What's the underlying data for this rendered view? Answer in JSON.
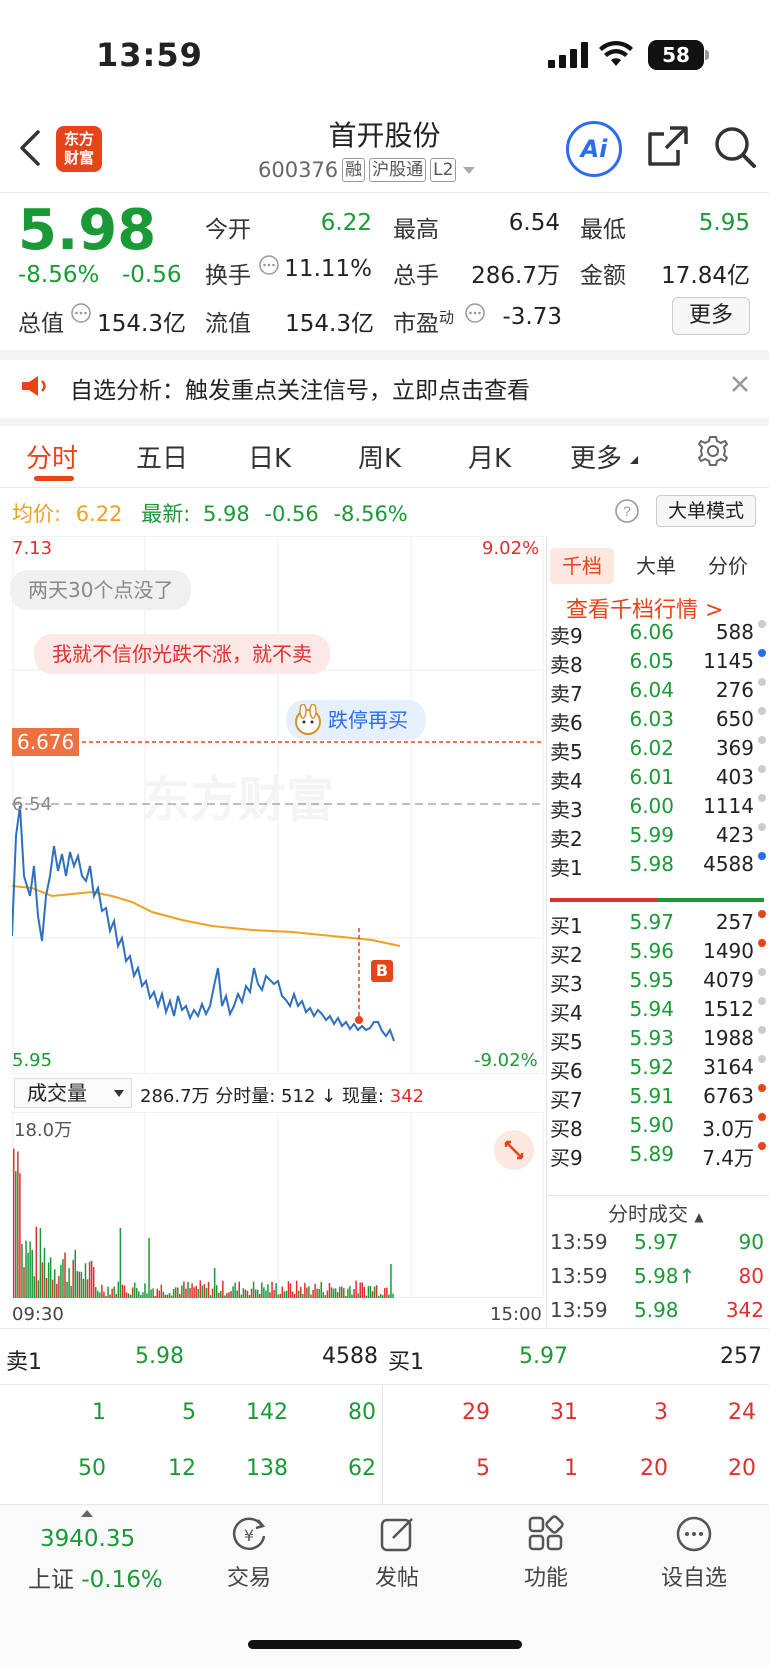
{
  "status_bar": {
    "time": "13:59",
    "battery": "58"
  },
  "header": {
    "title": "首开股份",
    "code": "600376",
    "tags": [
      "融",
      "沪股通",
      "L2"
    ],
    "logo_text": "东方财富"
  },
  "quote": {
    "price": "5.98",
    "change_pct": "-8.56%",
    "change": "-0.56",
    "fields": [
      {
        "label": "今开",
        "value": "6.22",
        "color": "green"
      },
      {
        "label": "最高",
        "value": "6.54",
        "color": "black"
      },
      {
        "label": "最低",
        "value": "5.95",
        "color": "green"
      },
      {
        "label": "换手",
        "value": "11.11%",
        "color": "black"
      },
      {
        "label": "总手",
        "value": "286.7万",
        "color": "black"
      },
      {
        "label": "金额",
        "value": "17.84亿",
        "color": "black"
      },
      {
        "label": "总值",
        "value": "154.3亿",
        "color": "black"
      },
      {
        "label": "流值",
        "value": "154.3亿",
        "color": "black"
      },
      {
        "label": "市盈",
        "label_sup": "动",
        "value": "-3.73",
        "color": "black"
      }
    ],
    "more_label": "更多"
  },
  "notice": {
    "text": "自选分析：触发重点关注信号，立即点击查看"
  },
  "tabs": [
    "分时",
    "五日",
    "日K",
    "周K",
    "月K",
    "更多"
  ],
  "intraday": {
    "avg_label": "均价:",
    "avg_value": "6.22",
    "latest_label": "最新:",
    "latest_value": "5.98",
    "latest_change": "-0.56",
    "latest_pct": "-8.56%",
    "mode_button": "大单模式",
    "y_top": "7.13",
    "y_bottom": "5.95",
    "pct_top": "9.02%",
    "pct_bottom": "-9.02%",
    "ref_price": "6.676",
    "high_price": "6.54",
    "watermark": "东方财富",
    "comment1": "两天30个点没了",
    "comment2": "我就不信你光跌不涨，就不卖",
    "comment3": "跌停再买",
    "b_marker": "B",
    "volume_label": "成交量",
    "volume_summary": "286.7万 分时量: 512",
    "volume_current_label": "现量:",
    "volume_current": "342",
    "volume_max": "18.0万",
    "time_start": "09:30",
    "time_end": "15:00"
  },
  "depth_tabs": [
    "千档",
    "大单",
    "分价"
  ],
  "depth_link": "查看千档行情 >",
  "asks": [
    {
      "label": "卖9",
      "price": "6.06",
      "vol": "588",
      "dot": "#cccccc"
    },
    {
      "label": "卖8",
      "price": "6.05",
      "vol": "1145",
      "dot": "#2a6cf6"
    },
    {
      "label": "卖7",
      "price": "6.04",
      "vol": "276",
      "dot": "#cccccc"
    },
    {
      "label": "卖6",
      "price": "6.03",
      "vol": "650",
      "dot": "#cccccc"
    },
    {
      "label": "卖5",
      "price": "6.02",
      "vol": "369",
      "dot": "#cccccc"
    },
    {
      "label": "卖4",
      "price": "6.01",
      "vol": "403",
      "dot": "#cccccc"
    },
    {
      "label": "卖3",
      "price": "6.00",
      "vol": "1114",
      "dot": "#cccccc"
    },
    {
      "label": "卖2",
      "price": "5.99",
      "vol": "423",
      "dot": "#cccccc"
    },
    {
      "label": "卖1",
      "price": "5.98",
      "vol": "4588",
      "dot": "#2a6cf6"
    }
  ],
  "bids": [
    {
      "label": "买1",
      "price": "5.97",
      "vol": "257",
      "dot": "#e8441a"
    },
    {
      "label": "买2",
      "price": "5.96",
      "vol": "1490",
      "dot": "#e8441a"
    },
    {
      "label": "买3",
      "price": "5.95",
      "vol": "4079",
      "dot": "#cccccc"
    },
    {
      "label": "买4",
      "price": "5.94",
      "vol": "1512",
      "dot": "#cccccc"
    },
    {
      "label": "买5",
      "price": "5.93",
      "vol": "1988",
      "dot": "#cccccc"
    },
    {
      "label": "买6",
      "price": "5.92",
      "vol": "3164",
      "dot": "#cccccc"
    },
    {
      "label": "买7",
      "price": "5.91",
      "vol": "6763",
      "dot": "#e8441a"
    },
    {
      "label": "买8",
      "price": "5.90",
      "vol": "3.0万",
      "dot": "#e8441a"
    },
    {
      "label": "买9",
      "price": "5.89",
      "vol": "7.4万",
      "dot": "#e8441a"
    }
  ],
  "trades_title": "分时成交",
  "trades": [
    {
      "time": "13:59",
      "price": "5.97",
      "vol": "90",
      "price_color": "green",
      "vol_color": "green"
    },
    {
      "time": "13:59",
      "price": "5.98↑",
      "vol": "80",
      "price_color": "green",
      "vol_color": "red"
    },
    {
      "time": "13:59",
      "price": "5.98",
      "vol": "342",
      "price_color": "green",
      "vol_color": "red"
    }
  ],
  "book": {
    "sell_label": "卖1",
    "sell_price": "5.98",
    "sell_vol": "4588",
    "buy_label": "买1",
    "buy_price": "5.97",
    "buy_vol": "257",
    "sell_rows": [
      [
        "1",
        "5",
        "142",
        "80"
      ],
      [
        "50",
        "12",
        "138",
        "62"
      ]
    ],
    "buy_rows": [
      [
        "29",
        "31",
        "3",
        "24"
      ],
      [
        "5",
        "1",
        "20",
        "20"
      ]
    ]
  },
  "bottom_nav": {
    "index_value": "3940.35",
    "index_name": "上证",
    "index_change": "-0.16%",
    "items": [
      "交易",
      "发帖",
      "功能",
      "设自选"
    ]
  }
}
